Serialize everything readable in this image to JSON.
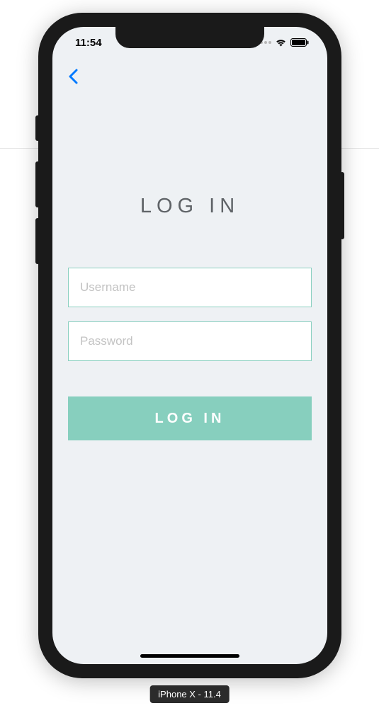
{
  "status_bar": {
    "time": "11:54"
  },
  "page": {
    "title": "LOG IN"
  },
  "form": {
    "username_placeholder": "Username",
    "password_placeholder": "Password",
    "login_button_label": "LOG IN"
  },
  "simulator": {
    "label": "iPhone X - 11.4"
  },
  "colors": {
    "accent": "#87cfbe",
    "screen_bg": "#eef1f4",
    "input_border": "#8ad0c0",
    "back_arrow": "#007aff"
  }
}
